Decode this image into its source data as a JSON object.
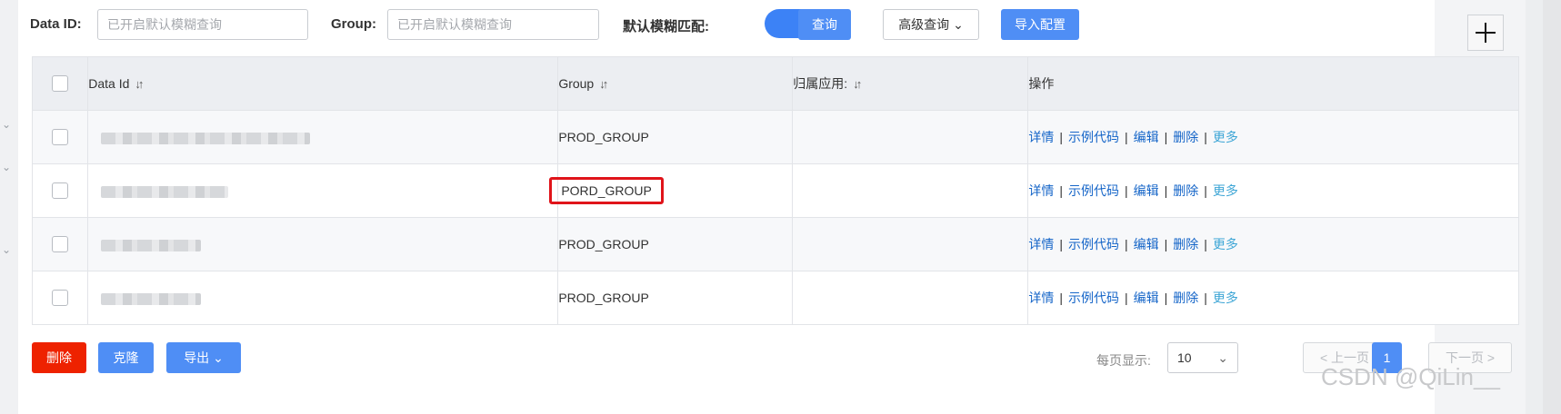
{
  "filters": {
    "data_id_label": "Data ID:",
    "data_id_placeholder": "已开启默认模糊查询",
    "group_label": "Group:",
    "group_placeholder": "已开启默认模糊查询",
    "fuzzy_label": "默认模糊匹配:",
    "fuzzy_enabled": true,
    "query_button": "查询",
    "advanced_button": "高级查询",
    "import_button": "导入配置"
  },
  "table": {
    "columns": [
      "Data Id",
      "Group",
      "归属应用:",
      "操作"
    ],
    "rows": [
      {
        "group": "PROD_GROUP",
        "app": "",
        "highlighted": false
      },
      {
        "group": "PORD_GROUP",
        "app": "",
        "highlighted": true
      },
      {
        "group": "PROD_GROUP",
        "app": "",
        "highlighted": false
      },
      {
        "group": "PROD_GROUP",
        "app": "",
        "highlighted": false
      }
    ],
    "actions": [
      "详情",
      "示例代码",
      "编辑",
      "删除",
      "更多"
    ]
  },
  "bulk": {
    "delete_button": "删除",
    "clone_button": "克隆",
    "export_button": "导出"
  },
  "pagination": {
    "per_page_label": "每页显示:",
    "per_page_value": "10",
    "prev_label": "< 上一页",
    "current_page": "1",
    "next_label": "下一页 >"
  },
  "watermark": "CSDN @QiLin__",
  "colors": {
    "primary": "#4f8ef5",
    "danger": "#ee2200",
    "link": "#1565c8",
    "highlight_border": "#e0141a"
  }
}
